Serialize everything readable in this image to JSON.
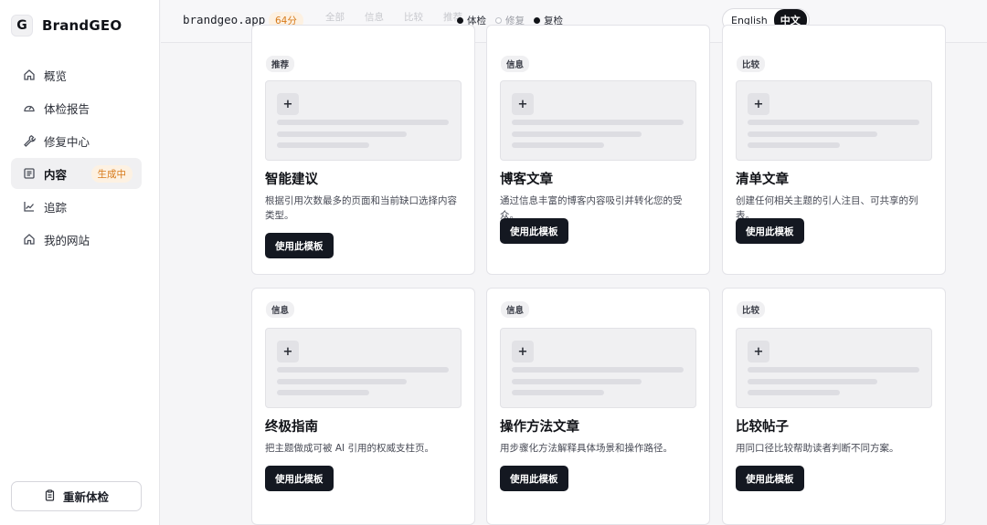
{
  "sidebar": {
    "brand_letter": "G",
    "brand_name": "BrandGEO",
    "items": [
      {
        "label": "概览",
        "icon": "home-icon"
      },
      {
        "label": "体检报告",
        "icon": "gauge-icon"
      },
      {
        "label": "修复中心",
        "icon": "wrench-icon"
      },
      {
        "label": "内容",
        "icon": "document-icon",
        "badge": "生成中",
        "active": true
      },
      {
        "label": "追踪",
        "icon": "chart-line-icon"
      },
      {
        "label": "我的网站",
        "icon": "home-icon"
      }
    ],
    "rescan_label": "重新体检"
  },
  "topbar": {
    "domain": "brandgeo.app",
    "score": "64分",
    "ghost_tabs": [
      "全部",
      "信息",
      "比较",
      "推荐"
    ],
    "legend": {
      "checkup": "体检",
      "repair": "修复",
      "recheck": "复检"
    },
    "lang_en": "English",
    "lang_zh": "中文"
  },
  "cards": [
    {
      "tag": "推荐",
      "title": "智能建议",
      "desc": "根据引用次数最多的页面和当前缺口选择内容类型。",
      "button": "使用此模板"
    },
    {
      "tag": "信息",
      "title": "博客文章",
      "desc": "通过信息丰富的博客内容吸引并转化您的受众。",
      "button": "使用此模板"
    },
    {
      "tag": "比较",
      "title": "清单文章",
      "desc": "创建任何相关主题的引人注目、可共享的列表。",
      "button": "使用此模板"
    },
    {
      "tag": "信息",
      "title": "终极指南",
      "desc": "把主题做成可被 AI 引用的权威支柱页。",
      "button": "使用此模板"
    },
    {
      "tag": "信息",
      "title": "操作方法文章",
      "desc": "用步骤化方法解释具体场景和操作路径。",
      "button": "使用此模板"
    },
    {
      "tag": "比较",
      "title": "比较帖子",
      "desc": "用同口径比较帮助读者判断不同方案。",
      "button": "使用此模板"
    }
  ],
  "colors": {
    "accent_badge_bg": "#fdf1e2",
    "accent_badge_text": "#d77a1a",
    "button_bg": "#141821"
  }
}
